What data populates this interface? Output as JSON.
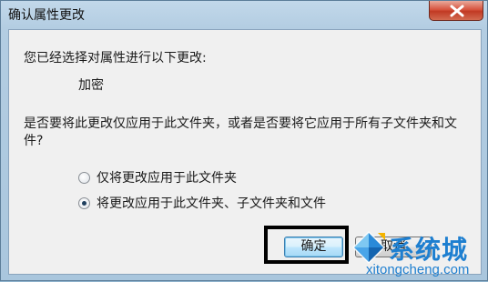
{
  "window": {
    "title": "确认属性更改"
  },
  "dialog": {
    "prompt": "您已经选择对属性进行以下更改:",
    "change_item": "加密",
    "question": "是否要将此更改仅应用于此文件夹，或者是否要将它应用于所有子文件夹和文件?",
    "options": [
      {
        "label": "仅将更改应用于此文件夹",
        "checked": false
      },
      {
        "label": "将更改应用于此文件夹、子文件夹和文件",
        "checked": true
      }
    ]
  },
  "buttons": {
    "ok": "确定",
    "cancel": "取消"
  },
  "watermark": {
    "brand": "系统城",
    "url": "xitongcheng.com"
  },
  "colors": {
    "accent": "#1e7fd0",
    "close_button": "#c13a24"
  }
}
